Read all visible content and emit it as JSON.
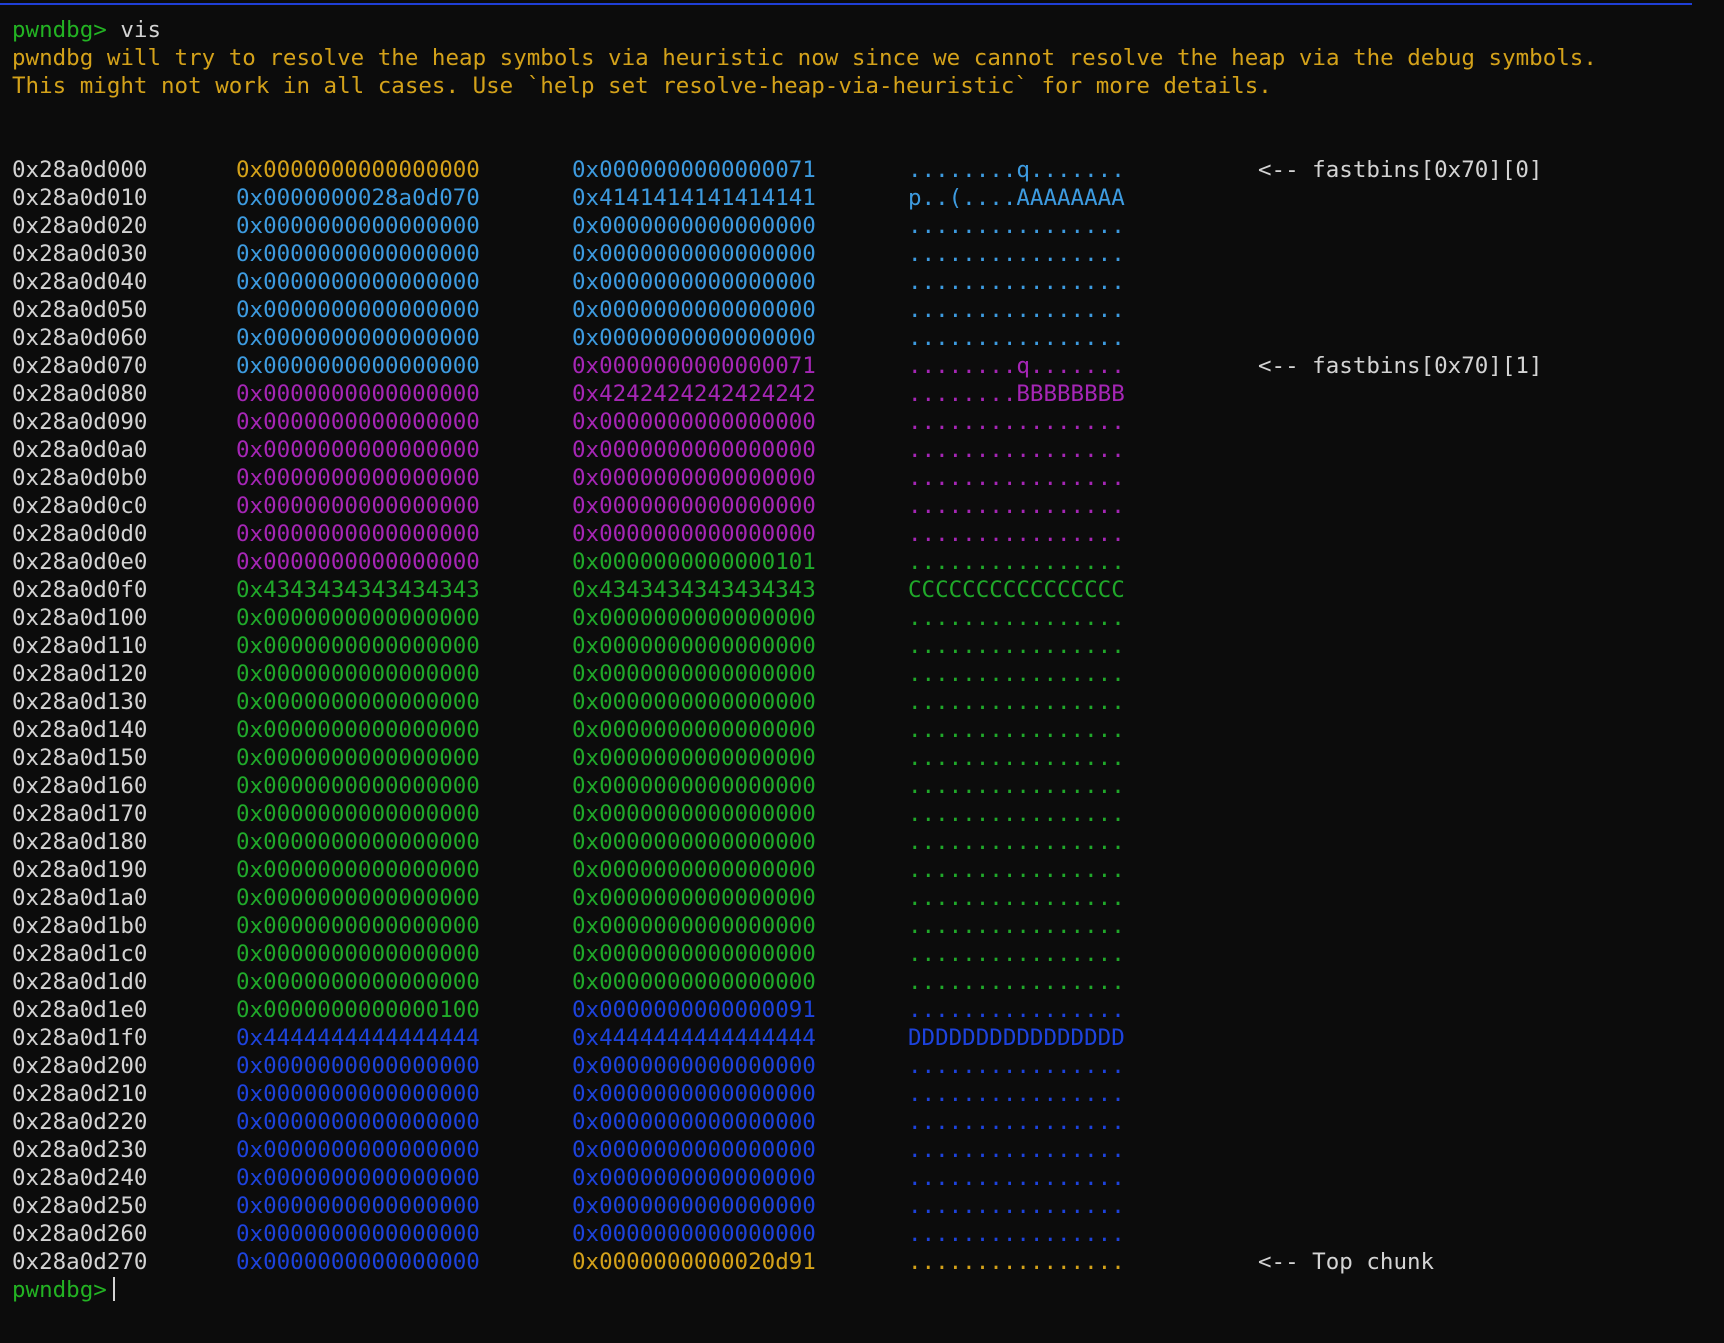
{
  "terminal": {
    "prompt": "pwndbg>",
    "command": "vis",
    "warning_lines": [
      "pwndbg will try to resolve the heap symbols via heuristic now since we cannot resolve the heap via the debug symbols.",
      "This might not work in all cases. Use `help set resolve-heap-via-heuristic` for more details."
    ],
    "colors": {
      "prompt": "#23b323",
      "warning": "#d4a21a",
      "address": "#d4d4d4",
      "note": "#d4d4d4",
      "orange": "#d4a21a",
      "cyan": "#3d9be0",
      "purple": "#a626b6",
      "green": "#20a92a",
      "blue": "#1d43dd"
    },
    "rows": [
      {
        "addr": "0x28a0d000",
        "w1": "0x0000000000000000",
        "c1": "orange",
        "w2": "0x0000000000000071",
        "c2": "cyan",
        "ascii": "........q.......",
        "ca": "cyan",
        "note": "<-- fastbins[0x70][0]"
      },
      {
        "addr": "0x28a0d010",
        "w1": "0x0000000028a0d070",
        "c1": "cyan",
        "w2": "0x4141414141414141",
        "c2": "cyan",
        "ascii": "p..(....AAAAAAAA",
        "ca": "cyan",
        "note": ""
      },
      {
        "addr": "0x28a0d020",
        "w1": "0x0000000000000000",
        "c1": "cyan",
        "w2": "0x0000000000000000",
        "c2": "cyan",
        "ascii": "................",
        "ca": "cyan",
        "note": ""
      },
      {
        "addr": "0x28a0d030",
        "w1": "0x0000000000000000",
        "c1": "cyan",
        "w2": "0x0000000000000000",
        "c2": "cyan",
        "ascii": "................",
        "ca": "cyan",
        "note": ""
      },
      {
        "addr": "0x28a0d040",
        "w1": "0x0000000000000000",
        "c1": "cyan",
        "w2": "0x0000000000000000",
        "c2": "cyan",
        "ascii": "................",
        "ca": "cyan",
        "note": ""
      },
      {
        "addr": "0x28a0d050",
        "w1": "0x0000000000000000",
        "c1": "cyan",
        "w2": "0x0000000000000000",
        "c2": "cyan",
        "ascii": "................",
        "ca": "cyan",
        "note": ""
      },
      {
        "addr": "0x28a0d060",
        "w1": "0x0000000000000000",
        "c1": "cyan",
        "w2": "0x0000000000000000",
        "c2": "cyan",
        "ascii": "................",
        "ca": "cyan",
        "note": ""
      },
      {
        "addr": "0x28a0d070",
        "w1": "0x0000000000000000",
        "c1": "cyan",
        "w2": "0x0000000000000071",
        "c2": "purple",
        "ascii": "........q.......",
        "ca": "purple",
        "note": "<-- fastbins[0x70][1]"
      },
      {
        "addr": "0x28a0d080",
        "w1": "0x0000000000000000",
        "c1": "purple",
        "w2": "0x4242424242424242",
        "c2": "purple",
        "ascii": "........BBBBBBBB",
        "ca": "purple",
        "note": ""
      },
      {
        "addr": "0x28a0d090",
        "w1": "0x0000000000000000",
        "c1": "purple",
        "w2": "0x0000000000000000",
        "c2": "purple",
        "ascii": "................",
        "ca": "purple",
        "note": ""
      },
      {
        "addr": "0x28a0d0a0",
        "w1": "0x0000000000000000",
        "c1": "purple",
        "w2": "0x0000000000000000",
        "c2": "purple",
        "ascii": "................",
        "ca": "purple",
        "note": ""
      },
      {
        "addr": "0x28a0d0b0",
        "w1": "0x0000000000000000",
        "c1": "purple",
        "w2": "0x0000000000000000",
        "c2": "purple",
        "ascii": "................",
        "ca": "purple",
        "note": ""
      },
      {
        "addr": "0x28a0d0c0",
        "w1": "0x0000000000000000",
        "c1": "purple",
        "w2": "0x0000000000000000",
        "c2": "purple",
        "ascii": "................",
        "ca": "purple",
        "note": ""
      },
      {
        "addr": "0x28a0d0d0",
        "w1": "0x0000000000000000",
        "c1": "purple",
        "w2": "0x0000000000000000",
        "c2": "purple",
        "ascii": "................",
        "ca": "purple",
        "note": ""
      },
      {
        "addr": "0x28a0d0e0",
        "w1": "0x0000000000000000",
        "c1": "purple",
        "w2": "0x0000000000000101",
        "c2": "green",
        "ascii": "................",
        "ca": "green",
        "note": ""
      },
      {
        "addr": "0x28a0d0f0",
        "w1": "0x4343434343434343",
        "c1": "green",
        "w2": "0x4343434343434343",
        "c2": "green",
        "ascii": "CCCCCCCCCCCCCCCC",
        "ca": "green",
        "note": ""
      },
      {
        "addr": "0x28a0d100",
        "w1": "0x0000000000000000",
        "c1": "green",
        "w2": "0x0000000000000000",
        "c2": "green",
        "ascii": "................",
        "ca": "green",
        "note": ""
      },
      {
        "addr": "0x28a0d110",
        "w1": "0x0000000000000000",
        "c1": "green",
        "w2": "0x0000000000000000",
        "c2": "green",
        "ascii": "................",
        "ca": "green",
        "note": ""
      },
      {
        "addr": "0x28a0d120",
        "w1": "0x0000000000000000",
        "c1": "green",
        "w2": "0x0000000000000000",
        "c2": "green",
        "ascii": "................",
        "ca": "green",
        "note": ""
      },
      {
        "addr": "0x28a0d130",
        "w1": "0x0000000000000000",
        "c1": "green",
        "w2": "0x0000000000000000",
        "c2": "green",
        "ascii": "................",
        "ca": "green",
        "note": ""
      },
      {
        "addr": "0x28a0d140",
        "w1": "0x0000000000000000",
        "c1": "green",
        "w2": "0x0000000000000000",
        "c2": "green",
        "ascii": "................",
        "ca": "green",
        "note": ""
      },
      {
        "addr": "0x28a0d150",
        "w1": "0x0000000000000000",
        "c1": "green",
        "w2": "0x0000000000000000",
        "c2": "green",
        "ascii": "................",
        "ca": "green",
        "note": ""
      },
      {
        "addr": "0x28a0d160",
        "w1": "0x0000000000000000",
        "c1": "green",
        "w2": "0x0000000000000000",
        "c2": "green",
        "ascii": "................",
        "ca": "green",
        "note": ""
      },
      {
        "addr": "0x28a0d170",
        "w1": "0x0000000000000000",
        "c1": "green",
        "w2": "0x0000000000000000",
        "c2": "green",
        "ascii": "................",
        "ca": "green",
        "note": ""
      },
      {
        "addr": "0x28a0d180",
        "w1": "0x0000000000000000",
        "c1": "green",
        "w2": "0x0000000000000000",
        "c2": "green",
        "ascii": "................",
        "ca": "green",
        "note": ""
      },
      {
        "addr": "0x28a0d190",
        "w1": "0x0000000000000000",
        "c1": "green",
        "w2": "0x0000000000000000",
        "c2": "green",
        "ascii": "................",
        "ca": "green",
        "note": ""
      },
      {
        "addr": "0x28a0d1a0",
        "w1": "0x0000000000000000",
        "c1": "green",
        "w2": "0x0000000000000000",
        "c2": "green",
        "ascii": "................",
        "ca": "green",
        "note": ""
      },
      {
        "addr": "0x28a0d1b0",
        "w1": "0x0000000000000000",
        "c1": "green",
        "w2": "0x0000000000000000",
        "c2": "green",
        "ascii": "................",
        "ca": "green",
        "note": ""
      },
      {
        "addr": "0x28a0d1c0",
        "w1": "0x0000000000000000",
        "c1": "green",
        "w2": "0x0000000000000000",
        "c2": "green",
        "ascii": "................",
        "ca": "green",
        "note": ""
      },
      {
        "addr": "0x28a0d1d0",
        "w1": "0x0000000000000000",
        "c1": "green",
        "w2": "0x0000000000000000",
        "c2": "green",
        "ascii": "................",
        "ca": "green",
        "note": ""
      },
      {
        "addr": "0x28a0d1e0",
        "w1": "0x0000000000000100",
        "c1": "green",
        "w2": "0x0000000000000091",
        "c2": "blue",
        "ascii": "................",
        "ca": "blue",
        "note": ""
      },
      {
        "addr": "0x28a0d1f0",
        "w1": "0x4444444444444444",
        "c1": "blue",
        "w2": "0x4444444444444444",
        "c2": "blue",
        "ascii": "DDDDDDDDDDDDDDDD",
        "ca": "blue",
        "note": ""
      },
      {
        "addr": "0x28a0d200",
        "w1": "0x0000000000000000",
        "c1": "blue",
        "w2": "0x0000000000000000",
        "c2": "blue",
        "ascii": "................",
        "ca": "blue",
        "note": ""
      },
      {
        "addr": "0x28a0d210",
        "w1": "0x0000000000000000",
        "c1": "blue",
        "w2": "0x0000000000000000",
        "c2": "blue",
        "ascii": "................",
        "ca": "blue",
        "note": ""
      },
      {
        "addr": "0x28a0d220",
        "w1": "0x0000000000000000",
        "c1": "blue",
        "w2": "0x0000000000000000",
        "c2": "blue",
        "ascii": "................",
        "ca": "blue",
        "note": ""
      },
      {
        "addr": "0x28a0d230",
        "w1": "0x0000000000000000",
        "c1": "blue",
        "w2": "0x0000000000000000",
        "c2": "blue",
        "ascii": "................",
        "ca": "blue",
        "note": ""
      },
      {
        "addr": "0x28a0d240",
        "w1": "0x0000000000000000",
        "c1": "blue",
        "w2": "0x0000000000000000",
        "c2": "blue",
        "ascii": "................",
        "ca": "blue",
        "note": ""
      },
      {
        "addr": "0x28a0d250",
        "w1": "0x0000000000000000",
        "c1": "blue",
        "w2": "0x0000000000000000",
        "c2": "blue",
        "ascii": "................",
        "ca": "blue",
        "note": ""
      },
      {
        "addr": "0x28a0d260",
        "w1": "0x0000000000000000",
        "c1": "blue",
        "w2": "0x0000000000000000",
        "c2": "blue",
        "ascii": "................",
        "ca": "blue",
        "note": ""
      },
      {
        "addr": "0x28a0d270",
        "w1": "0x0000000000000000",
        "c1": "blue",
        "w2": "0x0000000000020d91",
        "c2": "orange",
        "ascii": "................",
        "ca": "orange",
        "note": "<-- Top chunk"
      }
    ],
    "final_prompt": "pwndbg>"
  }
}
